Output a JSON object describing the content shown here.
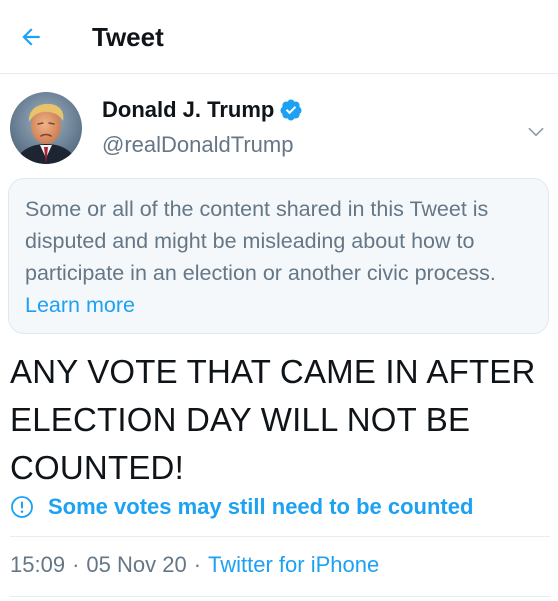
{
  "header": {
    "title": "Tweet",
    "back_icon": "back-arrow-icon"
  },
  "tweet": {
    "author": {
      "name": "Donald J. Trump",
      "handle": "@realDonaldTrump",
      "verified": true
    },
    "notice": {
      "text": "Some or all of the content shared in this Tweet is disputed and might be misleading about how to participate in an election or another civic process.",
      "link_label": "Learn more"
    },
    "text_lines": [
      "ANY VOTE THAT CAME IN AFTER",
      "ELECTION DAY WILL NOT BE",
      "COUNTED!"
    ],
    "label": {
      "icon": "exclamation-circle-icon",
      "text": "Some votes may still need to be counted"
    },
    "meta": {
      "time": "15:09",
      "date": "05 Nov 20",
      "source": "Twitter for iPhone",
      "separator": "·"
    }
  },
  "colors": {
    "accent": "#1da1f2",
    "secondary_text": "#657786",
    "primary_text": "#0f1419",
    "notice_bg": "#f5f8fa",
    "border": "#e6ecf0"
  }
}
